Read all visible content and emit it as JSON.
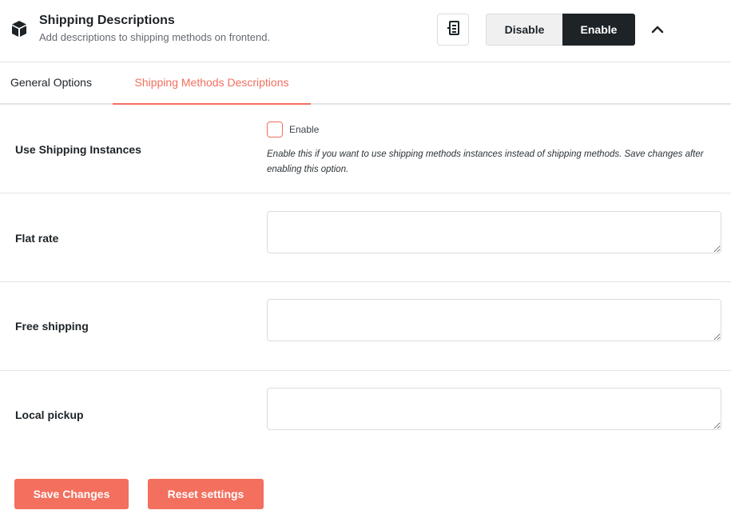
{
  "module": {
    "icon": "box-icon",
    "title": "Shipping Descriptions",
    "description": "Add descriptions to shipping methods on frontend.",
    "doc_icon": "document-icon",
    "toggle": {
      "disable_label": "Disable",
      "enable_label": "Enable",
      "state": "Enable"
    },
    "collapse_icon": "chevron-up-icon"
  },
  "tabs": [
    {
      "label": "General Options",
      "active": false
    },
    {
      "label": "Shipping Methods Descriptions",
      "active": true
    }
  ],
  "settings": {
    "use_instances": {
      "label": "Use Shipping Instances",
      "checkbox_label": "Enable",
      "checked": false,
      "help": "Enable this if you want to use shipping methods instances instead of shipping methods. Save changes after enabling this option."
    },
    "methods": [
      {
        "label": "Flat rate",
        "value": ""
      },
      {
        "label": "Free shipping",
        "value": ""
      },
      {
        "label": "Local pickup",
        "value": ""
      }
    ]
  },
  "actions": {
    "save_label": "Save Changes",
    "reset_label": "Reset settings"
  },
  "colors": {
    "accent": "#f36f5e",
    "dark": "#1d2327",
    "muted": "#f0f0f1",
    "border": "#e2e4e7"
  }
}
